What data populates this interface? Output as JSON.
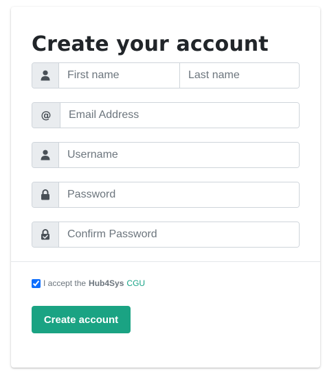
{
  "form": {
    "title": "Create your account",
    "fields": {
      "first_name": {
        "placeholder": "First name",
        "icon": "user-icon"
      },
      "last_name": {
        "placeholder": "Last name"
      },
      "email": {
        "placeholder": "Email Address",
        "icon": "at-sign-icon"
      },
      "username": {
        "placeholder": "Username",
        "icon": "user-icon"
      },
      "password": {
        "placeholder": "Password",
        "icon": "lock-icon"
      },
      "confirm_password": {
        "placeholder": "Confirm Password",
        "icon": "lock-check-icon"
      }
    },
    "terms": {
      "checked": true,
      "prefix": "I accept the",
      "brand": "Hub4Sys",
      "link_label": "CGU"
    },
    "submit_label": "Create account"
  },
  "colors": {
    "primary": "#1aa383",
    "link": "#17a386",
    "addon_bg": "#e9ecef",
    "border": "#ced4da",
    "title": "#212529"
  }
}
